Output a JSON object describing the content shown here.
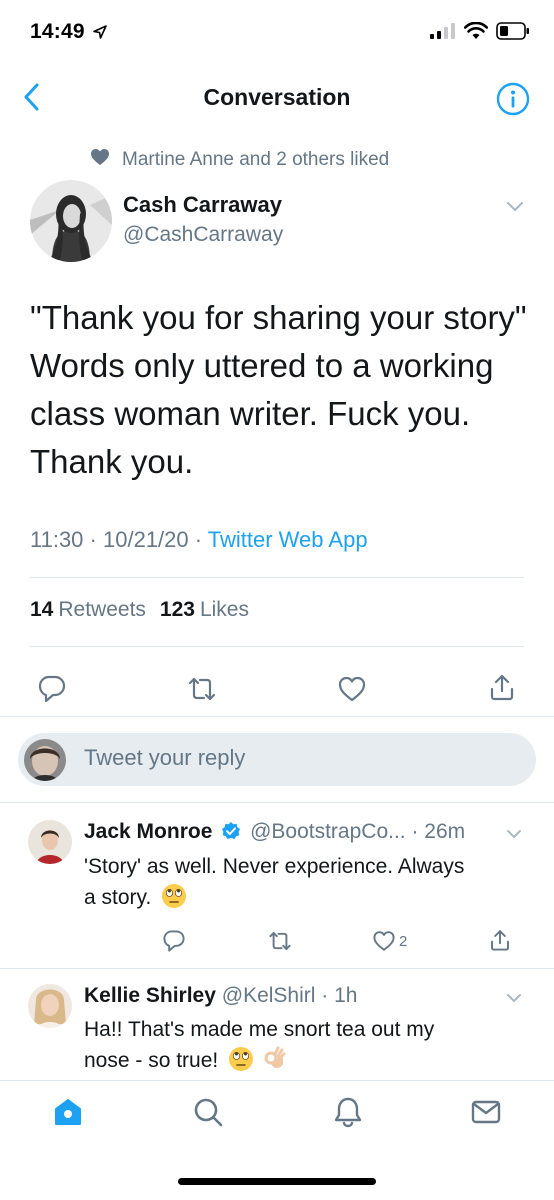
{
  "status_bar": {
    "time": "14:49"
  },
  "nav": {
    "title": "Conversation"
  },
  "social_context": {
    "text": "Martine Anne and 2 others liked"
  },
  "main_tweet": {
    "name": "Cash Carraway",
    "handle": "@CashCarraway",
    "text_lines": [
      "\"Thank you for sharing your story\"",
      "Words only uttered to a working",
      "class woman writer. Fuck you.",
      "Thank you."
    ],
    "time": "11:30",
    "separator": " · ",
    "date": "10/21/20",
    "source": "Twitter Web App",
    "retweets_count": "14",
    "retweets_label": "Retweets",
    "likes_count": "123",
    "likes_label": "Likes"
  },
  "reply_box": {
    "placeholder": "Tweet your reply"
  },
  "replies": [
    {
      "name": "Jack Monroe",
      "handle": "@BootstrapCo...",
      "age": "· 26m",
      "text_line1": "'Story' as well. Never experience. Always",
      "text_line2": "a story.",
      "like_count": "2"
    },
    {
      "name": "Kellie Shirley",
      "handle": "@KelShirl",
      "age": "· 1h",
      "text_line1": "Ha!! That's made me snort tea out my",
      "text_line2": "nose - so true!"
    }
  ],
  "colors": {
    "accent": "#1da1f2",
    "secondary_text": "#657786",
    "primary_text": "#14171a",
    "divider": "#e1e8ed",
    "verified": "#1da1f2"
  },
  "icons": {
    "back": "chevron-left-icon",
    "info": "info-icon",
    "liked": "heart-icon",
    "reply": "reply-icon",
    "retweet": "retweet-icon",
    "like": "heart-outline-icon",
    "share": "share-icon",
    "tabs": [
      "home-icon",
      "search-icon",
      "notifications-icon",
      "messages-icon"
    ]
  }
}
